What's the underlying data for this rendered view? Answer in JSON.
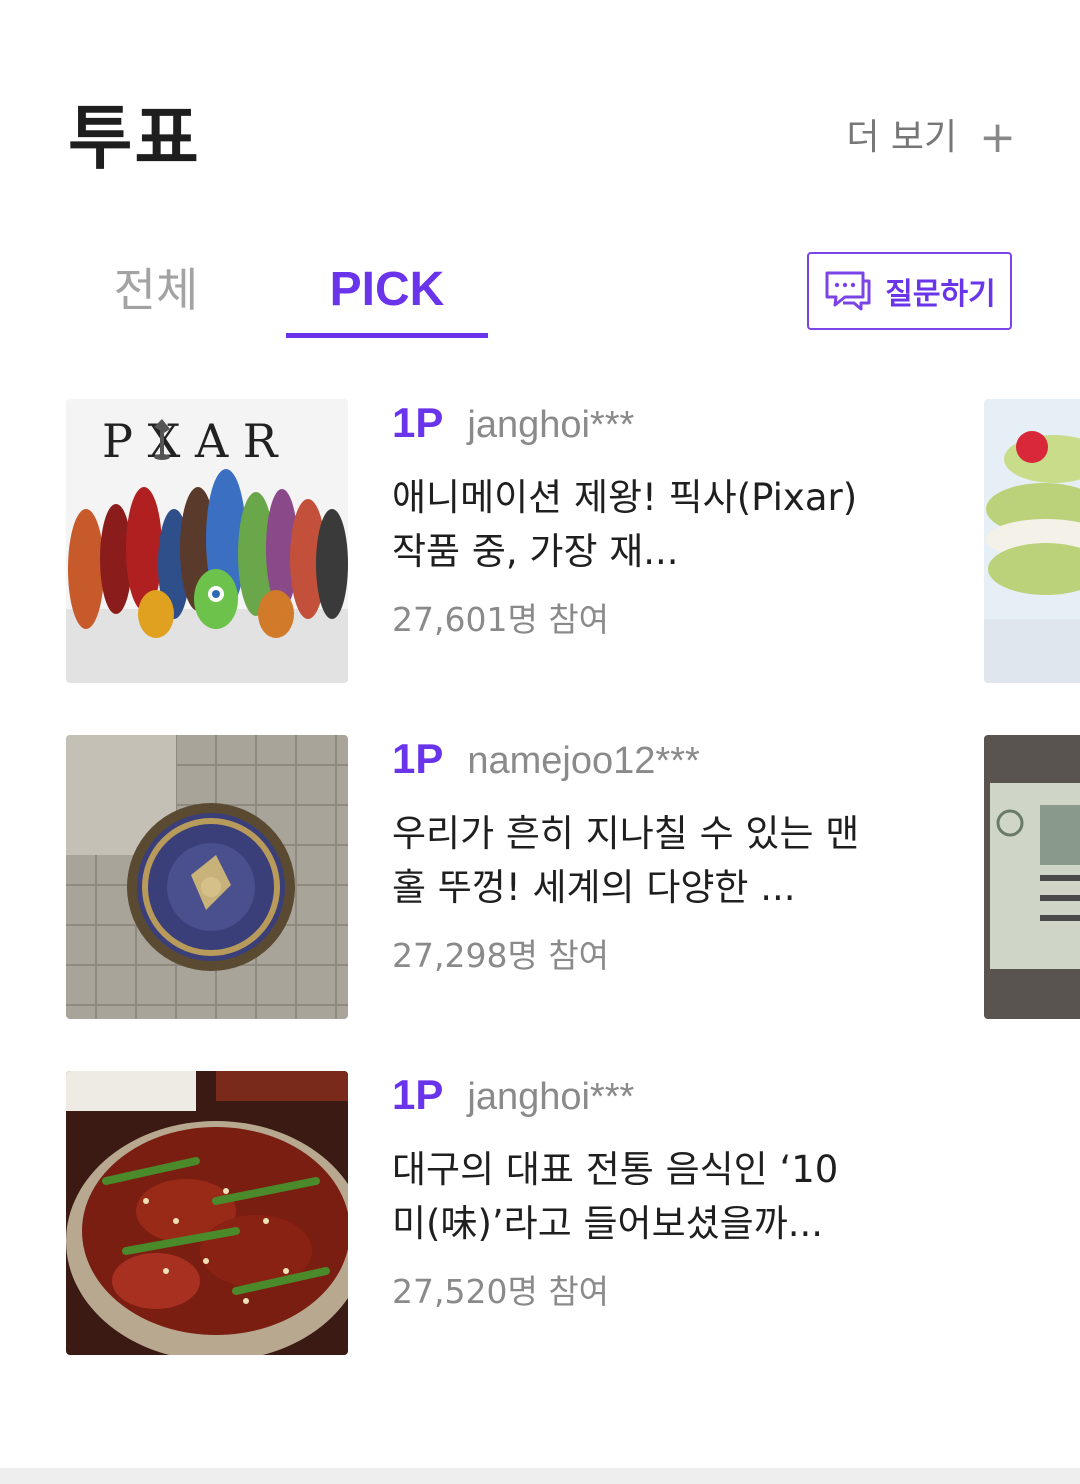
{
  "header": {
    "title": "투표",
    "more_label": "더 보기",
    "more_icon": "plus-icon"
  },
  "tabs": [
    {
      "label": "전체",
      "active": false
    },
    {
      "label": "PICK",
      "active": true
    }
  ],
  "ask_button": {
    "label": "질문하기",
    "icon": "chat-bubble-icon"
  },
  "colors": {
    "accent": "#6a35ea",
    "muted": "#8a8a8a",
    "inactive_tab": "#a3a3a3"
  },
  "polls": [
    {
      "rank": "1P",
      "author": "janghoi***",
      "title": "애니메이션 제왕! 픽사(Pixar) 작품 중, 가장 재...",
      "participants": "27,601명 참여",
      "thumbnail_text": "P  X A R"
    },
    {
      "rank": "1P",
      "author": "namejoo12***",
      "title": "우리가 흔히 지나칠 수 있는 맨홀 뚜껑! 세계의 다양한 ...",
      "participants": "27,298명 참여"
    },
    {
      "rank": "1P",
      "author": "janghoi***",
      "title": "대구의 대표 전통 음식인 ‘10미(味)’라고 들어보셨을까...",
      "participants": "27,520명 참여"
    }
  ]
}
